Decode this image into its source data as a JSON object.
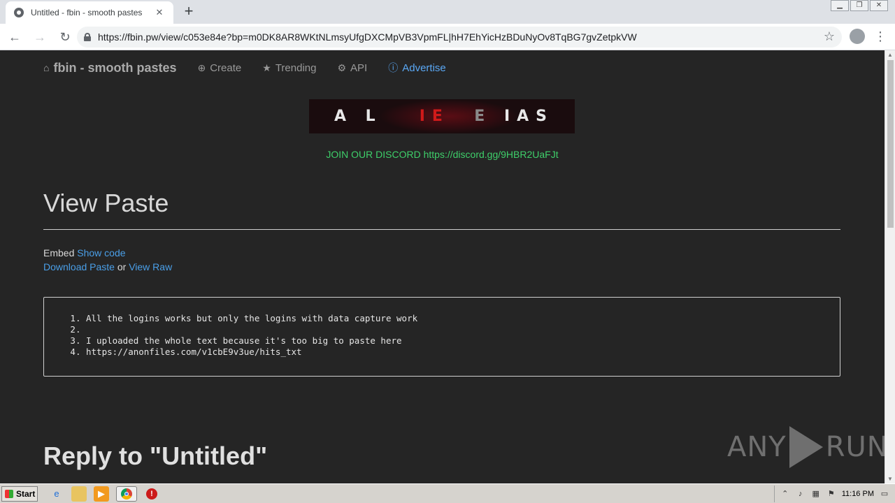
{
  "browser": {
    "tab_title": "Untitled - fbin - smooth pastes",
    "url": "https://fbin.pw/view/c053e84e?bp=m0DK8AR8WKtNLmsyUfgDXCMpVB3VpmFL|hH7EhYicHzBDuNyOv8TqBG7gvZetpkVW"
  },
  "nav": {
    "brand": "fbin - smooth pastes",
    "create": "Create",
    "trending": "Trending",
    "api": "API",
    "advertise": "Advertise"
  },
  "banner": {
    "part1": "A L ",
    "part2": "IE",
    "part3": "E ",
    "part4": "IAS"
  },
  "discord_text": "JOIN OUR DISCORD https://discord.gg/9HBR2UaFJt",
  "view": {
    "heading": "View Paste",
    "embed_label": "Embed",
    "show_code": "Show code",
    "download": "Download Paste",
    "or": "or",
    "view_raw": "View Raw"
  },
  "paste_lines": [
    "All the logins works but only the logins with data capture work",
    "",
    "I uploaded the whole text because it's too big to paste here",
    "https://anonfiles.com/v1cbE9v3ue/hits_txt"
  ],
  "reply_heading": "Reply to \"Untitled\"",
  "watermark": {
    "left": "ANY",
    "right": "RUN"
  },
  "taskbar": {
    "start": "Start",
    "clock": "11:16 PM"
  },
  "colors": {
    "page_bg": "#252525",
    "link": "#4a9fe8",
    "discord": "#3ecf6a",
    "accent_nav": "#5aa8f5"
  }
}
